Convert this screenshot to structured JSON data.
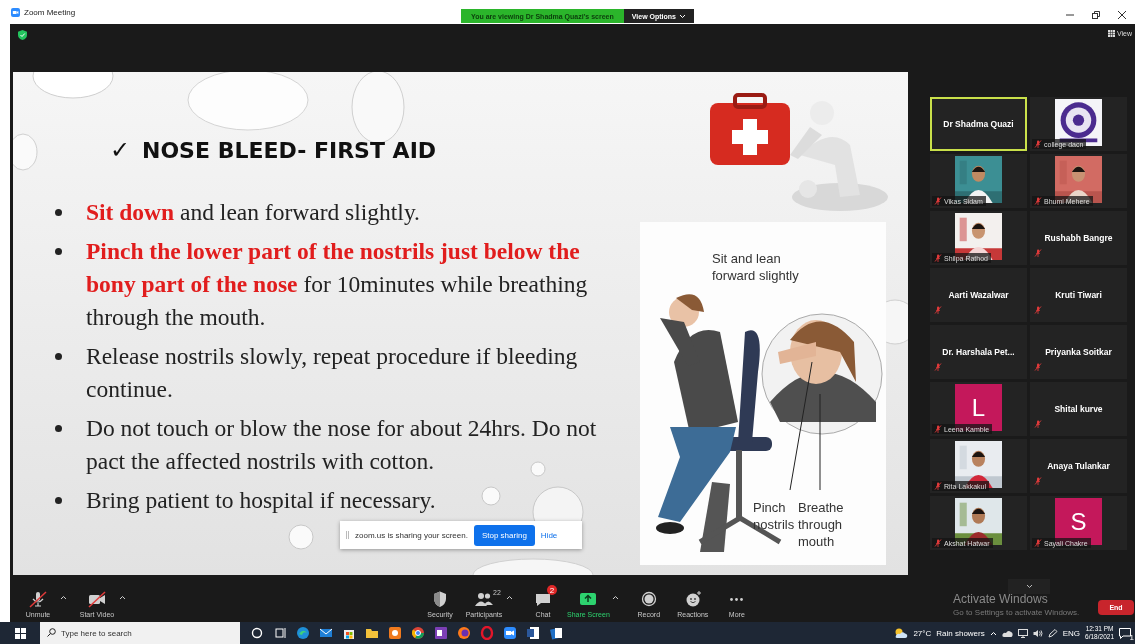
{
  "window": {
    "title": "Zoom Meeting"
  },
  "share_banner": {
    "text": "You are viewing Dr Shadma Quazi's screen",
    "view_options": "View Options"
  },
  "view_button": "View",
  "slide": {
    "check": "✓",
    "title": "NOSE BLEED- FIRST AID",
    "bullets": [
      {
        "highlight": "Sit down",
        "text": " and lean forward slightly."
      },
      {
        "highlight": "Pinch the lower part of the nostrils just below the bony part of the nose",
        "text": " for 10minutes while breathing through the mouth."
      },
      {
        "text": "Release nostrils slowly, repeat procedure if bleeding continue."
      },
      {
        "text": "Do not touch or blow the nose for about 24hrs. Do not pact the affected nostrils with cotton."
      },
      {
        "text": "Bring patient to hospital if necessary."
      }
    ],
    "figure_labels": [
      "Sit and lean forward slightly",
      "Pinch nostrils",
      "Breathe through mouth"
    ]
  },
  "share_notice": {
    "text": "zoom.us is sharing your screen.",
    "stop": "Stop sharing",
    "hide": "Hide"
  },
  "participants": [
    {
      "name": "Dr Shadma Quazi",
      "kind": "name",
      "muted": false,
      "active_speaker": true
    },
    {
      "name": "college dacn",
      "muted": true,
      "active_speaker": false
    },
    {
      "name": "Vikas Sidam",
      "muted": true,
      "active_speaker": false
    },
    {
      "name": "Bhumi Mehere",
      "muted": true,
      "active_speaker": false
    },
    {
      "name": "Shilpa Rathod",
      "muted": true,
      "active_speaker": false
    },
    {
      "name": "Rushabh Bangre",
      "kind": "name",
      "muted": true,
      "active_speaker": false
    },
    {
      "name": "Aarti Wazalwar",
      "kind": "name",
      "muted": true,
      "active_speaker": false
    },
    {
      "name": "Kruti Tiwari",
      "kind": "name",
      "muted": true,
      "active_speaker": false
    },
    {
      "name": "Dr. Harshala Pet...",
      "kind": "name",
      "muted": true,
      "active_speaker": false
    },
    {
      "name": "Priyanka Soitkar",
      "kind": "name",
      "muted": true,
      "active_speaker": false
    },
    {
      "name": "Leena Kamble",
      "kind": "letter",
      "letter": "L",
      "muted": true,
      "active_speaker": false
    },
    {
      "name": "Shital kurve",
      "kind": "name",
      "muted": true,
      "active_speaker": false
    },
    {
      "name": "Rita Lakkakul",
      "muted": true,
      "active_speaker": false
    },
    {
      "name": "Anaya Tulankar",
      "kind": "name",
      "muted": true,
      "active_speaker": false
    },
    {
      "name": "Akshat Hatwar",
      "muted": true,
      "active_speaker": false
    },
    {
      "name": "Sayali Chakre",
      "kind": "letter",
      "letter": "S",
      "muted": true,
      "active_speaker": false
    }
  ],
  "activation": {
    "title": "Activate Windows",
    "subtitle": "Go to Settings to activate Windows."
  },
  "toolbar": [
    {
      "kind": "mic",
      "label": "Unmute",
      "off": true,
      "menu": true
    },
    {
      "kind": "video",
      "label": "Start Video",
      "off": true,
      "menu": true
    },
    {
      "kind": "security",
      "label": "Security",
      "menu": false
    },
    {
      "kind": "participants",
      "label": "Participants",
      "count": "22",
      "menu": true
    },
    {
      "kind": "chat",
      "label": "Chat",
      "badge": "2",
      "menu": false
    },
    {
      "kind": "share",
      "label": "Share Screen",
      "menu": true
    },
    {
      "kind": "record",
      "label": "Record",
      "menu": false
    },
    {
      "kind": "reactions",
      "label": "Reactions",
      "menu": false
    },
    {
      "kind": "more",
      "label": "More",
      "menu": false
    }
  ],
  "end_button": "End",
  "taskbar": {
    "search_placeholder": "Type here to search",
    "temperature": "27°C",
    "weather": "Rain showers",
    "language": "ENG",
    "time": "12:31 PM",
    "date": "6/18/2021",
    "notifications": "1"
  }
}
